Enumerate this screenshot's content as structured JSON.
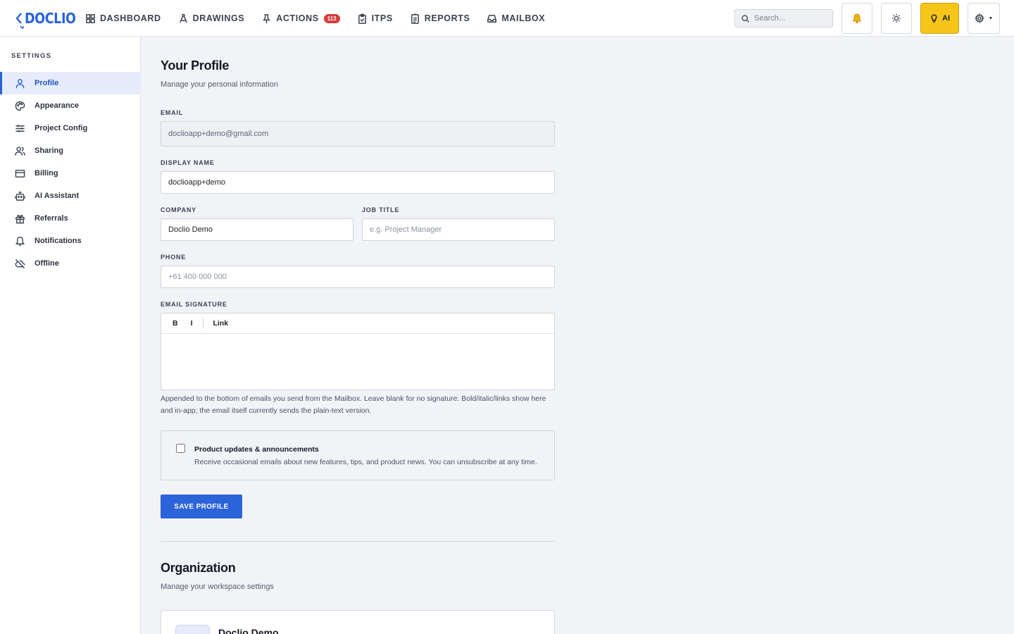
{
  "app": {
    "logo_text": "DOCLIO",
    "brand_color": "#2b63d9"
  },
  "nav": {
    "items": [
      {
        "label": "DASHBOARD",
        "icon": "grid-icon"
      },
      {
        "label": "DRAWINGS",
        "icon": "drafting-compass-icon"
      },
      {
        "label": "ACTIONS",
        "icon": "pin-icon",
        "badge": "113"
      },
      {
        "label": "ITPS",
        "icon": "clipboard-check-icon"
      },
      {
        "label": "REPORTS",
        "icon": "report-icon"
      },
      {
        "label": "MAILBOX",
        "icon": "inbox-icon"
      }
    ]
  },
  "header": {
    "search_placeholder": "Search...",
    "ai_label": "AI",
    "ai_color": "#f5c518"
  },
  "sidebar": {
    "title": "SETTINGS",
    "items": [
      {
        "label": "Profile",
        "icon": "user-icon",
        "active": true
      },
      {
        "label": "Appearance",
        "icon": "palette-icon"
      },
      {
        "label": "Project Config",
        "icon": "sliders-icon"
      },
      {
        "label": "Sharing",
        "icon": "users-icon"
      },
      {
        "label": "Billing",
        "icon": "credit-card-icon"
      },
      {
        "label": "AI Assistant",
        "icon": "bot-icon"
      },
      {
        "label": "Referrals",
        "icon": "gift-icon"
      },
      {
        "label": "Notifications",
        "icon": "bell-icon"
      },
      {
        "label": "Offline",
        "icon": "cloud-off-icon"
      }
    ]
  },
  "profile": {
    "title": "Your Profile",
    "subtitle": "Manage your personal information",
    "email_label": "EMAIL",
    "email_value": "doclioapp+demo@gmail.com",
    "display_name_label": "DISPLAY NAME",
    "display_name_value": "doclioapp+demo",
    "company_label": "COMPANY",
    "company_value": "Doclio Demo",
    "job_title_label": "JOB TITLE",
    "job_title_placeholder": "e.g. Project Manager",
    "phone_label": "PHONE",
    "phone_placeholder": "+61 400 000 000",
    "signature_label": "EMAIL SIGNATURE",
    "toolbar_bold": "B",
    "toolbar_italic": "I",
    "toolbar_link": "Link",
    "signature_help": "Appended to the bottom of emails you send from the Mailbox. Leave blank for no signature. Bold/italic/links show here and in-app; the email itself currently sends the plain-text version.",
    "updates_title": "Product updates & announcements",
    "updates_desc": "Receive occasional emails about new features, tips, and product news. You can unsubscribe at any time.",
    "updates_checked": false,
    "save_label": "SAVE PROFILE"
  },
  "organization": {
    "title": "Organization",
    "subtitle": "Manage your workspace settings",
    "name": "Doclio Demo"
  }
}
